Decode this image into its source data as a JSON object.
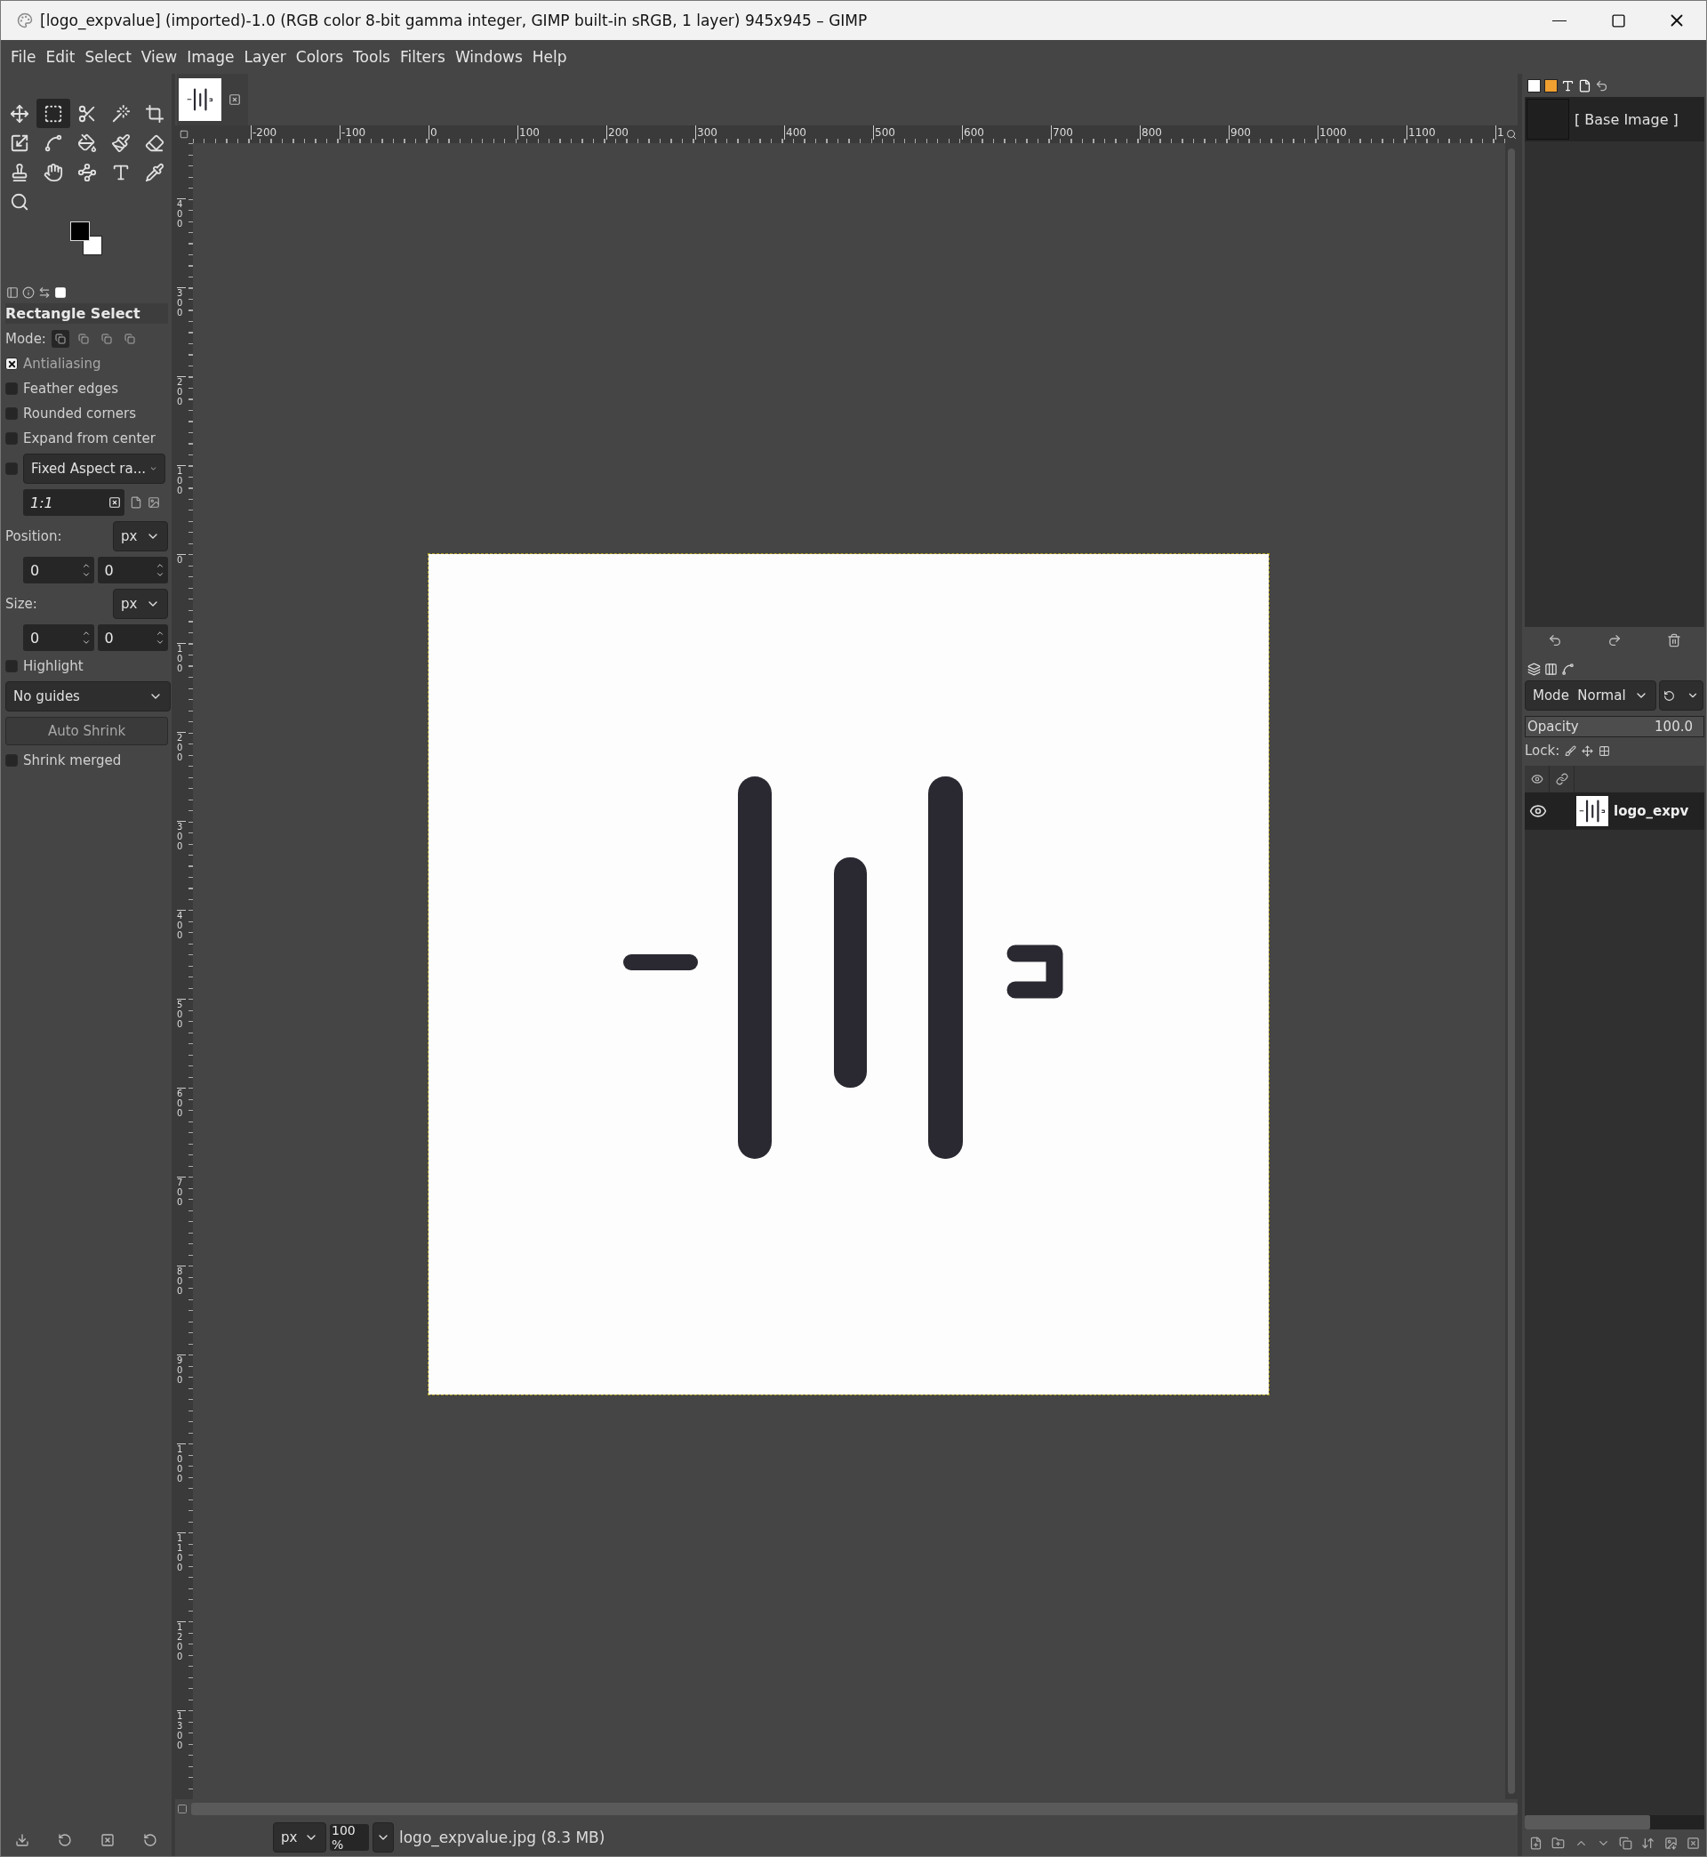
{
  "window": {
    "title": "[logo_expvalue] (imported)-1.0 (RGB color 8-bit gamma integer, GIMP built-in sRGB, 1 layer) 945x945 – GIMP"
  },
  "menu": [
    {
      "label": "File"
    },
    {
      "label": "Edit"
    },
    {
      "label": "Select"
    },
    {
      "label": "View"
    },
    {
      "label": "Image"
    },
    {
      "label": "Layer"
    },
    {
      "label": "Colors"
    },
    {
      "label": "Tools"
    },
    {
      "label": "Filters"
    },
    {
      "label": "Windows"
    },
    {
      "label": "Help"
    }
  ],
  "toolbox": {
    "tools": [
      {
        "kind": "move",
        "selected": false
      },
      {
        "kind": "rect_select",
        "selected": true
      },
      {
        "kind": "scissors",
        "selected": false
      },
      {
        "kind": "wand",
        "selected": false
      },
      {
        "kind": "crop",
        "selected": false
      },
      {
        "kind": "transform",
        "selected": false
      },
      {
        "kind": "warp",
        "selected": false
      },
      {
        "kind": "bucket",
        "selected": false
      },
      {
        "kind": "brush",
        "selected": false
      },
      {
        "kind": "eraser",
        "selected": false
      },
      {
        "kind": "clone",
        "selected": false
      },
      {
        "kind": "smudge",
        "selected": false
      },
      {
        "kind": "paths",
        "selected": false
      },
      {
        "kind": "text",
        "selected": false
      },
      {
        "kind": "picker",
        "selected": false
      },
      {
        "kind": "zoom",
        "selected": false
      }
    ],
    "swatches": [
      {
        "kind": "foreground",
        "color": "#000000"
      },
      {
        "kind": "background",
        "color": "#ffffff"
      }
    ]
  },
  "tool_options": {
    "title": "Rectangle Select",
    "mode_label": "Mode:",
    "modes": [
      {
        "selected": true
      },
      {
        "selected": false
      },
      {
        "selected": false
      },
      {
        "selected": false
      }
    ],
    "options": [
      {
        "kind": "checkbox",
        "label": "Antialiasing",
        "checked": true
      },
      {
        "kind": "checkbox",
        "label": "Feather edges",
        "checked": false
      },
      {
        "kind": "checkbox",
        "label": "Rounded corners",
        "checked": false
      },
      {
        "kind": "checkbox",
        "label": "Expand from center",
        "checked": false
      },
      {
        "kind": "check_dropdown",
        "label": "Fixed Aspect ra...",
        "checked": false
      },
      {
        "kind": "ratio",
        "value": "1:1"
      },
      {
        "kind": "unit",
        "label": "Position:",
        "unit": "px"
      },
      {
        "kind": "pair",
        "values": [
          "0",
          "0"
        ]
      },
      {
        "kind": "unit",
        "label": "Size:",
        "unit": "px"
      },
      {
        "kind": "pair",
        "values": [
          "0",
          "0"
        ]
      },
      {
        "kind": "checkbox",
        "label": "Highlight",
        "checked": false
      },
      {
        "kind": "dropdown",
        "label": "No guides"
      },
      {
        "kind": "button",
        "label": "Auto Shrink"
      },
      {
        "kind": "checkbox",
        "label": "Shrink merged",
        "checked": false
      }
    ]
  },
  "rulers": {
    "horizontal": [
      "-200",
      "-100",
      "0",
      "100",
      "200",
      "300",
      "400",
      "500",
      "600",
      "700",
      "800",
      "900",
      "1000",
      "1100",
      "1"
    ],
    "vertical": [
      "400",
      "300",
      "200",
      "100",
      "0",
      "100",
      "200",
      "300",
      "400",
      "500",
      "600",
      "700",
      "800",
      "900",
      "1000",
      "1100",
      "1200",
      "1300"
    ]
  },
  "status_bar": {
    "unit": "px",
    "zoom": "100 %",
    "file_info": "logo_expvalue.jpg (8.3 MB)"
  },
  "images_panel": {
    "items": [
      {
        "label": "[ Base Image ]"
      }
    ]
  },
  "layers_panel": {
    "mode_label": "Mode",
    "mode": "Normal",
    "opacity": {
      "label": "Opacity",
      "value": "100.0",
      "level": 1
    },
    "lock_label": "Lock:",
    "layers": [
      {
        "name": "logo_expv",
        "visible": true
      }
    ]
  }
}
